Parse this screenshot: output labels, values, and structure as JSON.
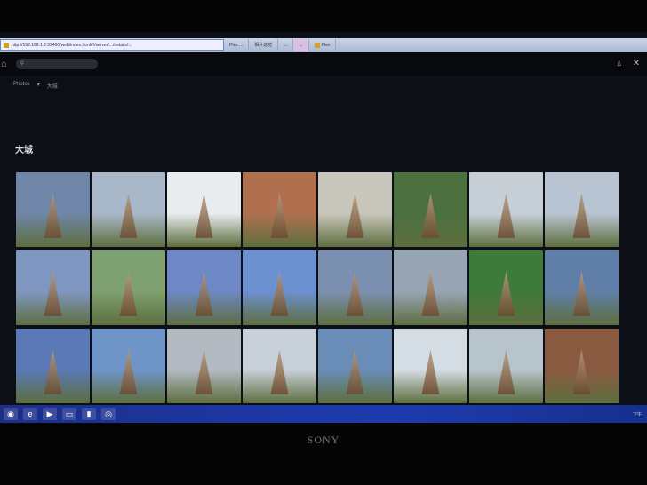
{
  "browser": {
    "url": "http://192.168.1.2:32400/web/index.html#!/server/.../details/...",
    "tabs": [
      "Plex ...",
      "相片总览",
      "...",
      "...",
      "Plex"
    ],
    "search_icon": "search-icon"
  },
  "header": {
    "search_placeholder": "",
    "home_icon": "home-icon",
    "right_icons": [
      "cast-icon",
      "settings-icon"
    ]
  },
  "breadcrumb": {
    "section": "Photos",
    "separator": "▾",
    "album": "大城"
  },
  "album_title": "大城",
  "photos": [
    "#6f86a8",
    "#a9b8c8",
    "#e8ecef",
    "#b07050",
    "#c9c6bb",
    "#4d7040",
    "#c6cfd6",
    "#b9c4d2",
    "#7f97c0",
    "#7fa070",
    "#6d88c4",
    "#6d90d0",
    "#7b8fb0",
    "#96a4b4",
    "#3e7a3a",
    "#5f7fa8",
    "#5a79b5",
    "#6f95c8",
    "#b3bac2",
    "#c8d0da",
    "#6a8db8",
    "#d5dde4",
    "#b8c4cc",
    "#8a5a40"
  ],
  "taskbar": {
    "apps": [
      "windows",
      "ie",
      "media",
      "explorer",
      "terminal",
      "chrome"
    ],
    "tray_time": "下午"
  },
  "monitor_brand": "SONY"
}
